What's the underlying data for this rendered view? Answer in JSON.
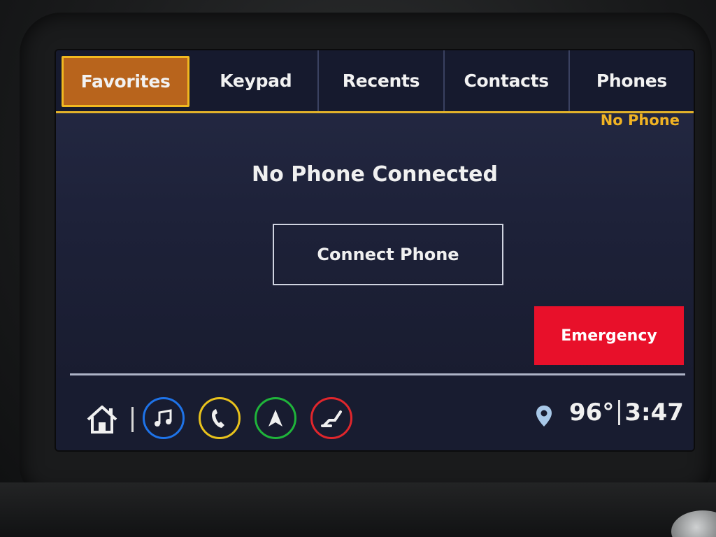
{
  "tabs": [
    {
      "label": "Favorites",
      "active": true
    },
    {
      "label": "Keypad",
      "active": false
    },
    {
      "label": "Recents",
      "active": false
    },
    {
      "label": "Contacts",
      "active": false
    },
    {
      "label": "Phones",
      "active": false
    }
  ],
  "status": {
    "phone_state": "No Phone"
  },
  "main": {
    "headline": "No Phone Connected",
    "connect_button": "Connect Phone",
    "emergency_button": "Emergency"
  },
  "bottombar": {
    "apps": [
      {
        "icon": "music-note-icon",
        "ring_color": "#1e73e8"
      },
      {
        "icon": "phone-handset-icon",
        "ring_color": "#e8c21c"
      },
      {
        "icon": "navigation-arrow-icon",
        "ring_color": "#1fb43a"
      },
      {
        "icon": "seat-icon",
        "ring_color": "#e0262c"
      }
    ],
    "temperature": "96°",
    "time": "3:47"
  },
  "colors": {
    "accent_tab": "#b8641c",
    "accent_border": "#f0b820",
    "emergency": "#e8102a"
  }
}
